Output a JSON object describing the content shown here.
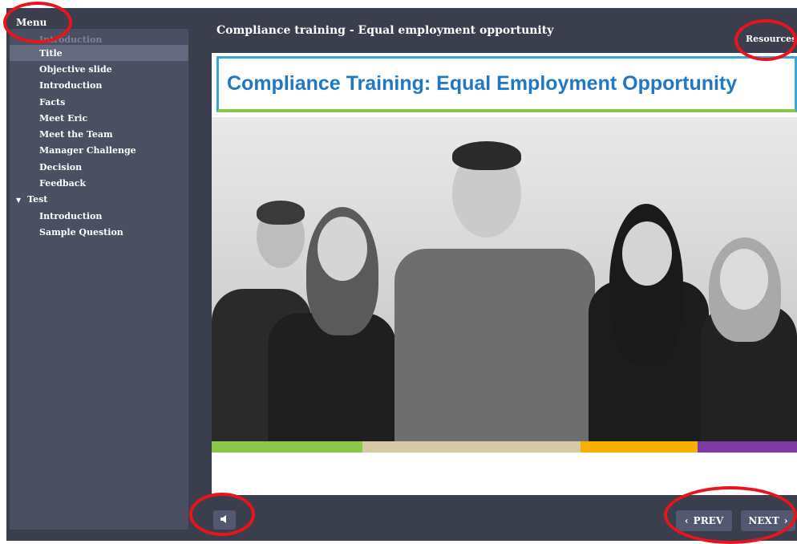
{
  "sidebar": {
    "menu_label": "Menu",
    "items": [
      {
        "label": "Introduction",
        "type": "faded"
      },
      {
        "label": "Title",
        "type": "child",
        "selected": true
      },
      {
        "label": "Objective slide",
        "type": "child"
      },
      {
        "label": "Introduction",
        "type": "child"
      },
      {
        "label": "Facts",
        "type": "child"
      },
      {
        "label": "Meet Eric",
        "type": "child"
      },
      {
        "label": "Meet the Team",
        "type": "child"
      },
      {
        "label": "Manager Challenge",
        "type": "child"
      },
      {
        "label": "Decision",
        "type": "child"
      },
      {
        "label": "Feedback",
        "type": "child"
      },
      {
        "label": "Test",
        "type": "section"
      },
      {
        "label": "Introduction",
        "type": "child"
      },
      {
        "label": "Sample Question",
        "type": "child"
      }
    ]
  },
  "header": {
    "course_title": "Compliance training - Equal employment opportunity",
    "resources_label": "Resources"
  },
  "slide": {
    "banner_title": "Compliance Training: Equal Employment Opportunity",
    "color_bar": [
      "#8cc64a",
      "#d6c9a6",
      "#f5b000",
      "#7c3aa4"
    ]
  },
  "controls": {
    "audio_icon": "speaker-icon",
    "prev_label": "PREV",
    "next_label": "NEXT",
    "prev_icon": "‹",
    "next_icon": "›"
  },
  "colors": {
    "annotation": "#e8141e",
    "player_bg": "#3a3e4d",
    "sidebar_bg": "#4a4f62",
    "selected_item": "#646b81",
    "banner_text": "#1f78c6"
  }
}
